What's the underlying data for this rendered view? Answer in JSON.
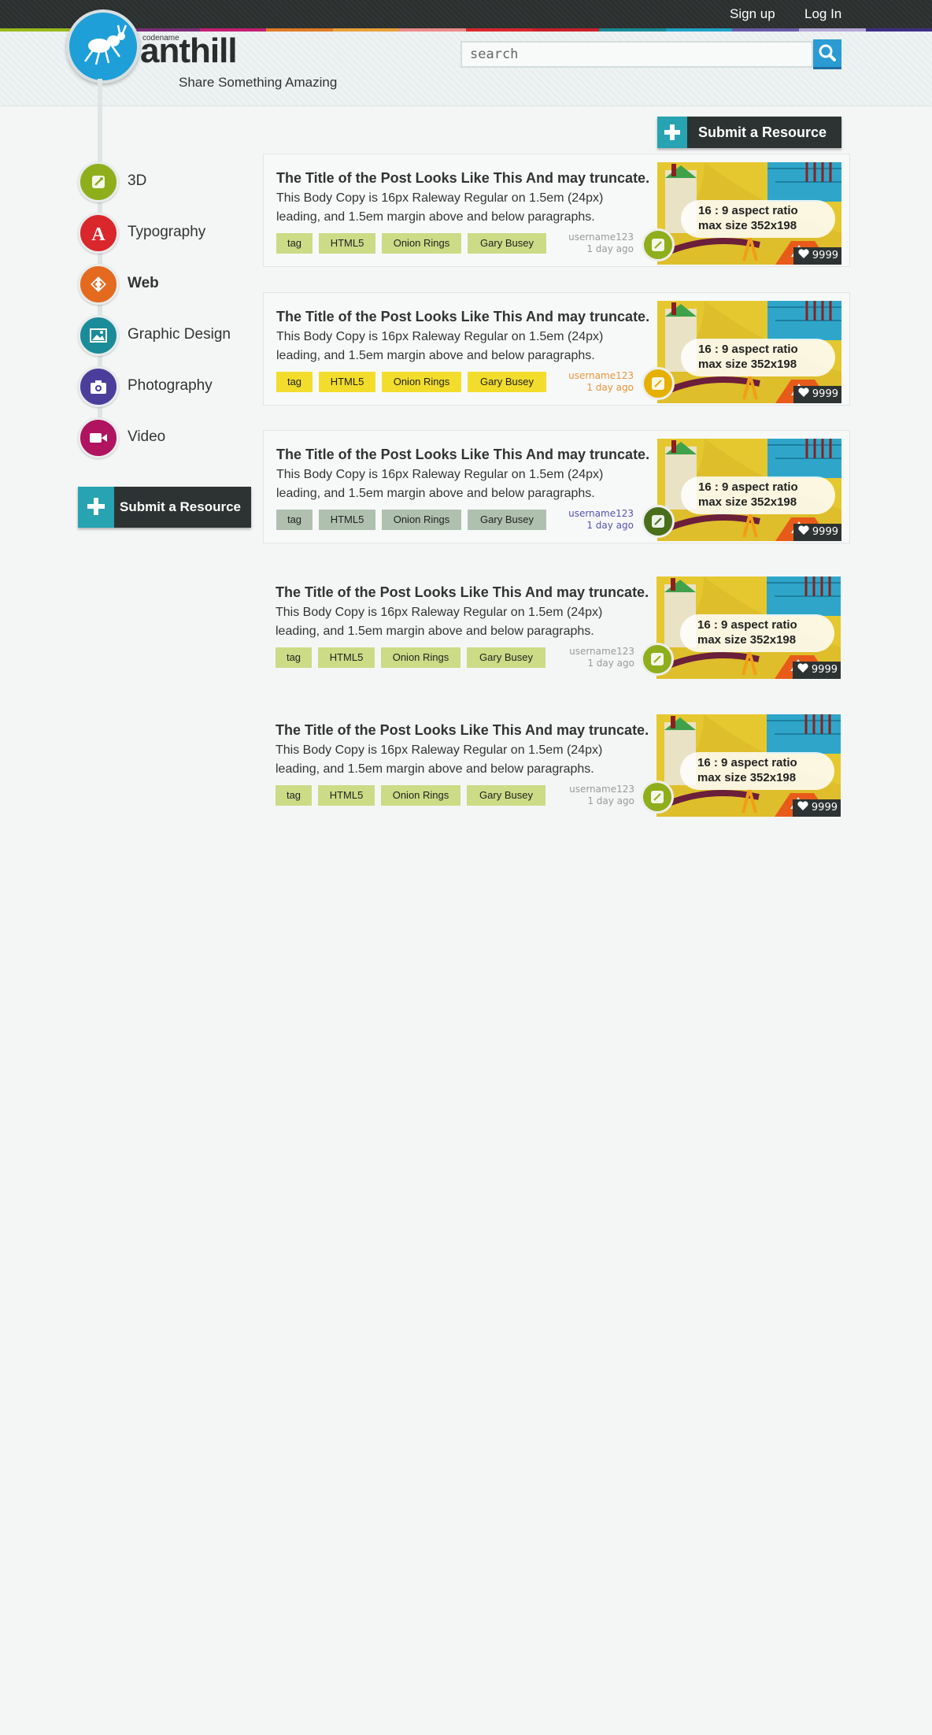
{
  "topbar": {
    "signup": "Sign up",
    "login": "Log In"
  },
  "brand": {
    "codename": "codename",
    "name": "anthill",
    "tagline": "Share Something Amazing"
  },
  "search": {
    "placeholder": "search"
  },
  "categories": [
    {
      "label": "3D",
      "color": "#8fae1b",
      "icon": "wand-icon"
    },
    {
      "label": "Typography",
      "color": "#d9272c",
      "icon": "letter-a-icon"
    },
    {
      "label": "Web",
      "color": "#e46a1f",
      "icon": "code-icon",
      "active": true
    },
    {
      "label": "Graphic Design",
      "color": "#1a8b99",
      "icon": "image-icon"
    },
    {
      "label": "Photography",
      "color": "#4b3e9b",
      "icon": "camera-icon"
    },
    {
      "label": "Video",
      "color": "#b0135f",
      "icon": "video-icon"
    }
  ],
  "submit_label": "Submit a Resource",
  "posts": [
    {
      "title": "The Title of the Post Looks Like This And may truncate.",
      "body": "This Body Copy is 16px Raleway Regular on 1.5em (24px) leading,  and 1.5em margin above and below paragraphs.",
      "tags": [
        "tag",
        "HTML5",
        "Onion Rings",
        "Gary Busey"
      ],
      "user": "username123",
      "time": "1 day ago",
      "ratio": "16 : 9 aspect ratio",
      "maxsize": "max size 352x198",
      "likes": "9999",
      "tag_color": "#ccdb86",
      "meta_color": "#999999",
      "badge_color": "#8fae1b"
    },
    {
      "title": "The Title of the Post Looks Like This And may truncate.",
      "body": "This Body Copy is 16px Raleway Regular on 1.5em (24px) leading,  and 1.5em margin above and below paragraphs.",
      "tags": [
        "tag",
        "HTML5",
        "Onion Rings",
        "Gary Busey"
      ],
      "user": "username123",
      "time": "1 day ago",
      "ratio": "16 : 9 aspect ratio",
      "maxsize": "max size 352x198",
      "likes": "9999",
      "tag_color": "#f2dd2d",
      "meta_color": "#e8943a",
      "badge_color": "#e5b000"
    },
    {
      "title": "The Title of the Post Looks Like This And may truncate.",
      "body": "This Body Copy is 16px Raleway Regular on 1.5em (24px) leading,  and 1.5em margin above and below paragraphs.",
      "tags": [
        "tag",
        "HTML5",
        "Onion Rings",
        "Gary Busey"
      ],
      "user": "username123",
      "time": "1 day ago",
      "ratio": "16 : 9 aspect ratio",
      "maxsize": "max size 352x198",
      "likes": "9999",
      "tag_color": "#afc0af",
      "meta_color": "#5552b0",
      "badge_color": "#4a6e1a"
    },
    {
      "title": "The Title of the Post Looks Like This And may truncate.",
      "body": "This Body Copy is 16px Raleway Regular on 1.5em (24px) leading,  and 1.5em margin above and below paragraphs.",
      "tags": [
        "tag",
        "HTML5",
        "Onion Rings",
        "Gary Busey"
      ],
      "user": "username123",
      "time": "1 day ago",
      "ratio": "16 : 9 aspect ratio",
      "maxsize": "max size 352x198",
      "likes": "9999",
      "tag_color": "#ccdb86",
      "meta_color": "#999999",
      "badge_color": "#8fae1b"
    },
    {
      "title": "The Title of the Post Looks Like This And may truncate.",
      "body": "This Body Copy is 16px Raleway Regular on 1.5em (24px) leading,  and 1.5em margin above and below paragraphs.",
      "tags": [
        "tag",
        "HTML5",
        "Onion Rings",
        "Gary Busey"
      ],
      "user": "username123",
      "time": "1 day ago",
      "ratio": "16 : 9 aspect ratio",
      "maxsize": "max size 352x198",
      "likes": "9999",
      "tag_color": "#ccdb86",
      "meta_color": "#999999",
      "badge_color": "#8fae1b"
    }
  ]
}
